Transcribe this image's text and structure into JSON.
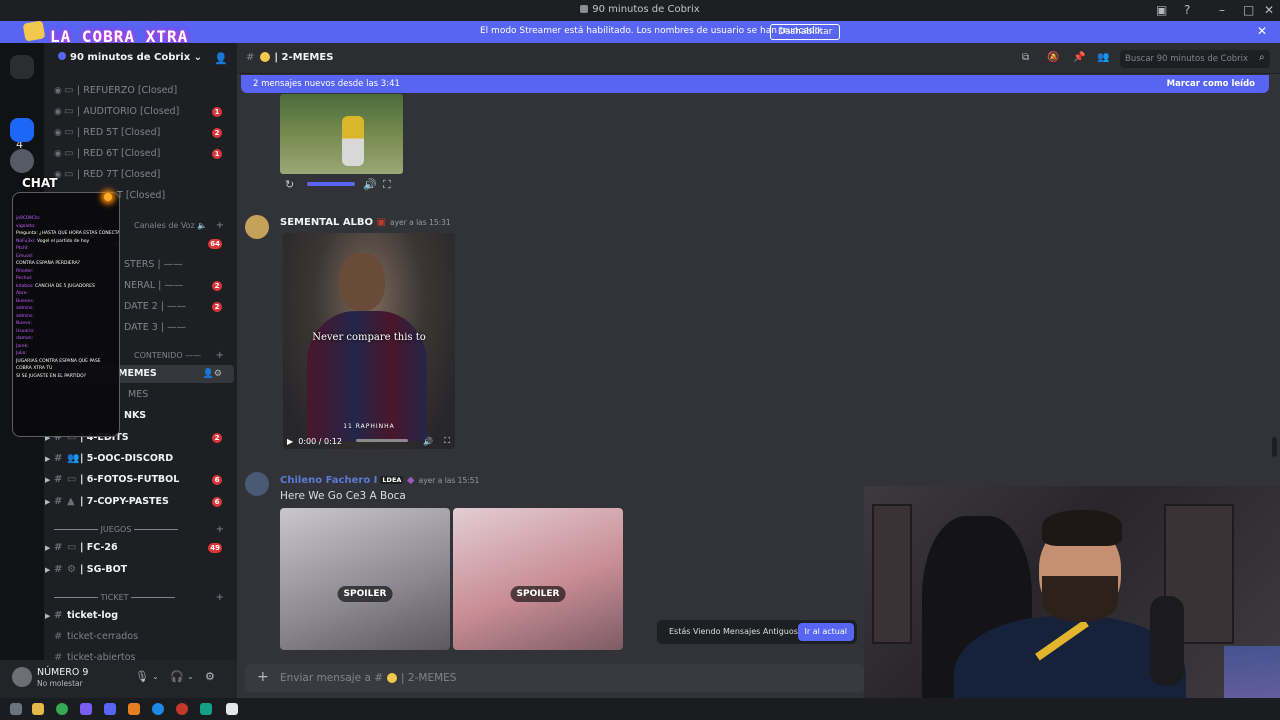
{
  "window": {
    "title": "90 minutos de Cobrix"
  },
  "overlay": {
    "logo_text": "LA COBRA XTRA",
    "chat_label": "CHAT"
  },
  "banner": {
    "text": "El modo Streamer está habilitado. Los nombres de usuario se han truncado.",
    "button": "Deshabilitar"
  },
  "rail": {
    "count": "4"
  },
  "server": {
    "name": "90 minutos de Cobrix"
  },
  "channels": [
    {
      "name": "| REFUERZO [Closed]",
      "badge": ""
    },
    {
      "name": "| AUDITORIO [Closed]",
      "badge": "1"
    },
    {
      "name": "| RED 5T [Closed]",
      "badge": "2"
    },
    {
      "name": "| RED 6T [Closed]",
      "badge": "1"
    },
    {
      "name": "| RED 7T [Closed]",
      "badge": ""
    },
    {
      "name": "T [Closed]",
      "badge": ""
    }
  ],
  "voice": {
    "category": "Canales de Voz",
    "items": [
      {
        "name": "a",
        "badge": "64"
      },
      {
        "name": "STERS |",
        "badge": ""
      },
      {
        "name": "NERAL |",
        "badge": "2"
      },
      {
        "name": "DATE 2 |",
        "badge": "2"
      },
      {
        "name": "DATE 3 |",
        "badge": ""
      }
    ]
  },
  "text_category": "CONTENIDO",
  "text_channels": [
    {
      "name": "MEMES",
      "badge": ""
    },
    {
      "name": "MES",
      "badge": ""
    },
    {
      "name": "NKS",
      "badge": ""
    },
    {
      "name": "| 4-EDITS",
      "badge": "2"
    },
    {
      "name": "| 5-OOC-DISCORD",
      "badge": ""
    },
    {
      "name": "| 6-FOTOS-FUTBOL",
      "badge": "6"
    },
    {
      "name": "| 7-COPY-PASTES",
      "badge": "6"
    }
  ],
  "games_category": "JUEGOS",
  "games_channels": [
    {
      "name": "| FC-26",
      "badge": "49"
    },
    {
      "name": "| SG-BOT",
      "badge": ""
    }
  ],
  "ticket_category": "TICKET",
  "ticket_channels": [
    {
      "name": "ticket-log"
    },
    {
      "name": "ticket-cerrados"
    },
    {
      "name": "ticket-abiertos"
    }
  ],
  "user": {
    "name": "NÚMERO 9",
    "status": "No molestar"
  },
  "header": {
    "channel": "| 2-MEMES",
    "search_placeholder": "Buscar 90 minutos de Cobrix"
  },
  "newbar": {
    "left": "2 mensajes nuevos desde las 3:41",
    "right": "Marcar como leído"
  },
  "messages": [
    {
      "author": "SEMENTAL ALBO",
      "time": "ayer a las 15:31",
      "video_caption": "Never compare this to",
      "video_name": "11 RAPHINHA",
      "video_time": "0:00 / 0:12"
    },
    {
      "author": "Chileno Fachero I",
      "tag": "LDEA",
      "time": "ayer a las 15:51",
      "text": "Here We Go Ce3 A Boca",
      "spoiler": "SPOILER"
    }
  ],
  "old_messages": {
    "text": "Estás Viendo Mensajes Antiguos",
    "button": "Ir al actual"
  },
  "composer": {
    "placeholder": "Enviar mensaje a #",
    "channel": "| 2-MEMES"
  },
  "stream_chat_lines": [
    {
      "user": "jo9C09Clo",
      "msg": ""
    },
    {
      "user": "vigoloto",
      "msg": ""
    },
    {
      "user": "",
      "msg": "Pregunta: ¿HASTA QUE HORA ESTAS CONECTADO? ¿HORA ESTAS CONECTADO?"
    },
    {
      "user": "NoFu3xi",
      "msg": "Vogel el partido de hoy"
    },
    {
      "user": "Ptchl",
      "msg": ""
    },
    {
      "user": "Emuod",
      "msg": ""
    },
    {
      "user": "",
      "msg": "CONTRA ESPAÑA PERDIERA?"
    },
    {
      "user": "Rhoder",
      "msg": ""
    },
    {
      "user": "Pechul",
      "msg": ""
    },
    {
      "user": "kdabos",
      "msg": "CANCHA DE 5 JUGADORES"
    },
    {
      "user": "Abre",
      "msg": ""
    },
    {
      "user": "Buenos",
      "msg": ""
    },
    {
      "user": "admins",
      "msg": ""
    },
    {
      "user": "admins",
      "msg": ""
    },
    {
      "user": "Nuevo",
      "msg": ""
    },
    {
      "user": "Usuario",
      "msg": ""
    },
    {
      "user": "damon",
      "msg": ""
    },
    {
      "user": "Jarek",
      "msg": ""
    },
    {
      "user": "Julio",
      "msg": ""
    },
    {
      "user": "",
      "msg": "JUGARIAS CONTRA ESPAÑA QUE PASE"
    },
    {
      "user": "",
      "msg": "COBRA XTRA TU"
    },
    {
      "user": "",
      "msg": "SI SE JUGASTE EN EL PARTIDO?"
    }
  ],
  "colors": {
    "accent": "#5865f2",
    "badge": "#da373c",
    "sidebar": "#1e1f22",
    "chat": "#313338"
  }
}
